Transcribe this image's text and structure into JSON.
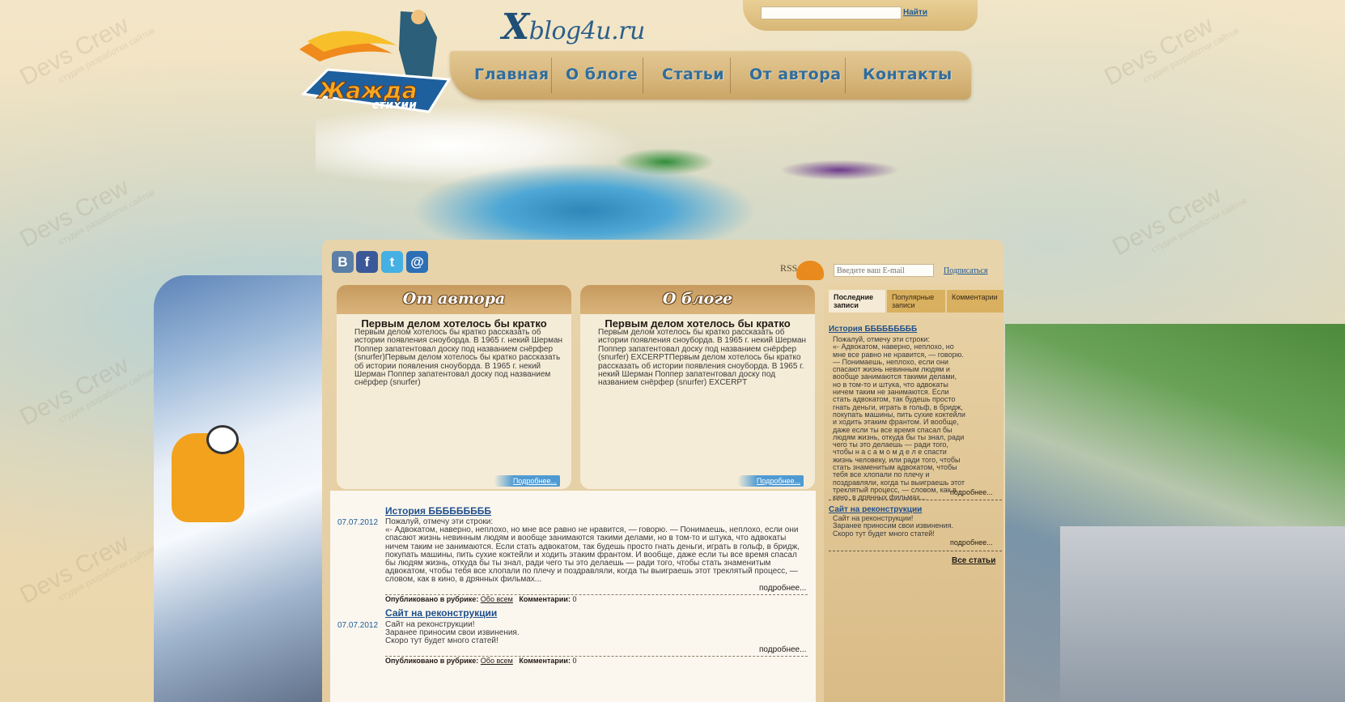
{
  "watermark": {
    "brand": "Devs Crew",
    "tagline": "студия разработки сайтов"
  },
  "header": {
    "logo_line1": "Жажда",
    "logo_line2": "стихии",
    "site_name_x": "X",
    "site_name_rest": "blog4u.ru"
  },
  "search": {
    "value": "",
    "button_label": "Найти"
  },
  "nav": {
    "items": [
      {
        "label": "Главная"
      },
      {
        "label": "О блоге"
      },
      {
        "label": "Статьи"
      },
      {
        "label": "От автора"
      },
      {
        "label": "Контакты"
      }
    ]
  },
  "social": {
    "icons": [
      {
        "name": "vkontakte-icon",
        "glyph": "B",
        "color": "#5b7fa6"
      },
      {
        "name": "facebook-icon",
        "glyph": "f",
        "color": "#3b5998"
      },
      {
        "name": "twitter-icon",
        "glyph": "t",
        "color": "#45b0e3"
      },
      {
        "name": "mail-icon",
        "glyph": "@",
        "color": "#2c6fb6"
      }
    ]
  },
  "subscribe": {
    "rss_label": "RSS",
    "email_placeholder": "Введите ваш E-mail",
    "button_label": "Подписаться"
  },
  "boxes": [
    {
      "title": "От автора",
      "heading": "Первым делом хотелось бы кратко",
      "text": "Первым делом хотелось бы кратко рассказать об истории появления сноуборда. В 1965 г. некий Шерман Поппер запатентовал доску под названием снёрфер (snurfer)Первым делом хотелось бы кратко рассказать об истории появления сноуборда. В 1965 г. некий Шерман Поппер запатентовал доску под названием снёрфер (snurfer)",
      "more": "Подробнее..."
    },
    {
      "title": "О блоге",
      "heading": "Первым делом хотелось бы кратко",
      "text": "Первым делом хотелось бы кратко рассказать об истории появления сноуборда. В 1965 г. некий Шерман Поппер запатентовал доску под названием снёрфер (snurfer) EXCERPTПервым делом хотелось бы кратко рассказать об истории появления сноуборда. В 1965 г. некий Шерман Поппер запатентовал доску под названием снёрфер (snurfer) EXCERPT",
      "more": "Подробнее..."
    }
  ],
  "posts": [
    {
      "title": "История БББББББББ",
      "date": "07.07.2012",
      "body": "Пожалуй, отмечу эти строки:\n«- Адвокатом, наверно, неплохо, но мне все равно не нравится, — говорю. — Понимаешь, неплохо, если они спасают жизнь невинным людям и вообще занимаются такими делами, но в том-то и штука, что адвокаты ничем таким не занимаются. Если стать адвокатом, так будешь просто гнать деньги, играть в гольф, в бридж, покупать машины, пить сухие коктейли и ходить этаким франтом. И вообще, даже если ты все время спасал бы людям жизнь, откуда бы ты знал, ради чего ты это делаешь — ради того, чтобы стать знаменитым адвокатом, чтобы тебя все хлопали по плечу и поздравляли, когда ты выиграешь этот треклятый процесс, — словом, как в кино, в дрянных фильмах...",
      "more": "подробнее...",
      "published_label": "Опубликовано в рубрике:",
      "category": "Обо всем",
      "comments_label": "Комментарии:",
      "comments": "0"
    },
    {
      "title": "Сайт на реконструкции",
      "date": "07.07.2012",
      "body": "Сайт на реконструкции!\nЗаранее приносим свои извинения.\nСкоро тут будет много статей!",
      "more": "подробнее...",
      "published_label": "Опубликовано в рубрике:",
      "category": "Обо всем",
      "comments_label": "Комментарии:",
      "comments": "0"
    }
  ],
  "sidebar": {
    "tabs": [
      {
        "label": "Последние записи"
      },
      {
        "label": "Популярные записи"
      },
      {
        "label": "Комментарии"
      }
    ],
    "posts": [
      {
        "title": "История БББББББББ",
        "body": "Пожалуй, отмечу эти строки:\n«- Адвокатом, наверно, неплохо, но мне все равно не нравится, — говорю. — Понимаешь, неплохо, если они спасают жизнь невинным людям и вообще занимаются такими делами, но в том-то и штука, что адвокаты ничем таким не занимаются. Если стать адвокатом, так будешь просто гнать деньги, играть в гольф, в бридж, покупать машины, пить сухие коктейли и ходить этаким франтом. И вообще, даже если ты все время спасал бы людям жизнь, откуда бы ты знал, ради чего ты это делаешь — ради того, чтобы н а с а м о м д е л е спасти жизнь человеку, или ради того, чтобы стать знаменитым адвокатом, чтобы тебя все хлопали по плечу и поздравляли, когда ты выиграешь этот треклятый процесс, — словом, как в кино, в дрянных фильмах...",
        "more": "подробнее..."
      },
      {
        "title": "Сайт на реконструкции",
        "body": "Сайт на реконструкции!\nЗаранее приносим свои извинения.\nСкоро тут будет много статей!",
        "more": "подробнее..."
      }
    ],
    "all_posts": "Все статьи"
  }
}
